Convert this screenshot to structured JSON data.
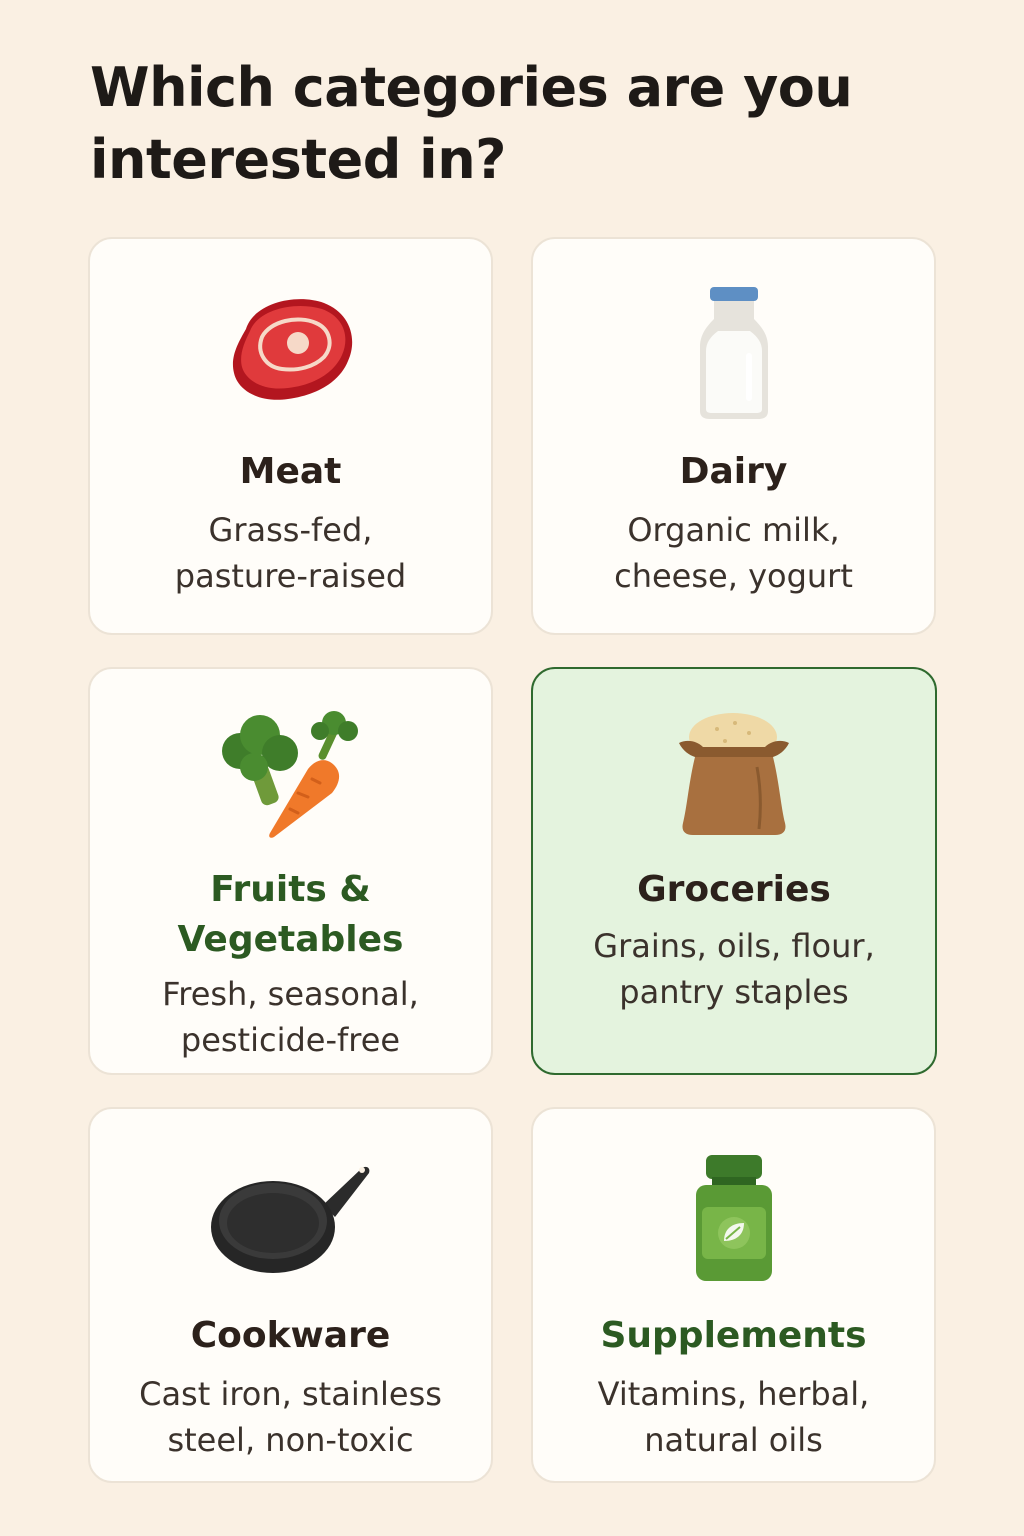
{
  "title": "Which categories are you interested in?",
  "title_lines": [
    "Which categories are you",
    "interested in?"
  ],
  "colors": {
    "background": "#faf0e3",
    "card_background": "#fffdf9",
    "selected_background": "#e4f3de",
    "selected_border": "#2f6a2f",
    "accent_green_text": "#2c5a22"
  },
  "categories": [
    {
      "name": "Meat",
      "description_lines": [
        "Grass-fed,",
        "pasture-raised"
      ],
      "icon": "steak-icon",
      "selected": false
    },
    {
      "name": "Dairy",
      "description_lines": [
        "Organic milk,",
        "cheese, yogurt"
      ],
      "icon": "milk-bottle-icon",
      "selected": false
    },
    {
      "name_lines": [
        "Fruits &",
        "Vegetables"
      ],
      "description_lines": [
        "Fresh, seasonal,",
        "pesticide-free"
      ],
      "icon": "broccoli-carrot-icon",
      "selected": false
    },
    {
      "name": "Groceries",
      "description_lines": [
        "Grains, oils, flour,",
        "pantry staples"
      ],
      "icon": "grain-sack-icon",
      "selected": true
    },
    {
      "name": "Cookware",
      "description_lines": [
        "Cast iron, stainless",
        "steel, non-toxic"
      ],
      "icon": "frying-pan-icon",
      "selected": false
    },
    {
      "name": "Supplements",
      "description_lines": [
        "Vitamins, herbal,",
        "natural oils"
      ],
      "icon": "supplement-bottle-icon",
      "selected": false
    }
  ]
}
